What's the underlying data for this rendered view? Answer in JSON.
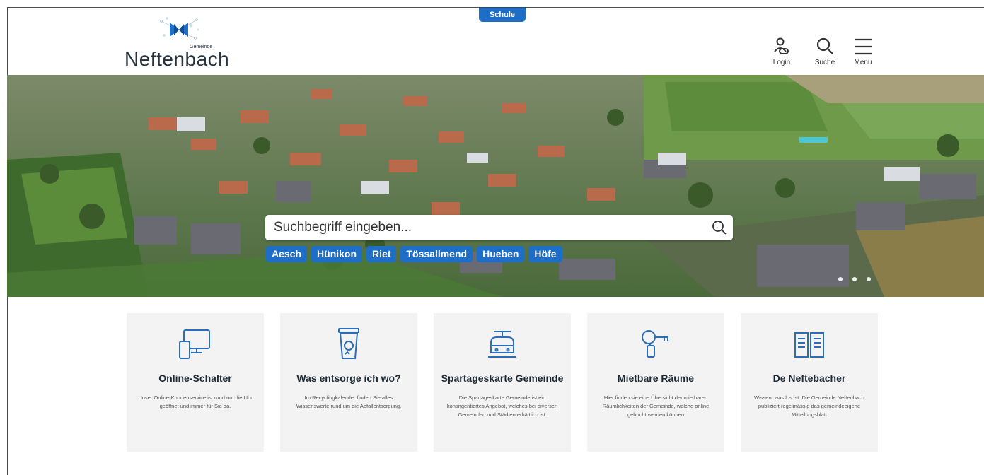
{
  "top_badge": "Schule",
  "logo": {
    "name": "Neftenbach",
    "small": "Gemeinde"
  },
  "header": {
    "login": "Login",
    "search": "Suche",
    "menu": "Menu"
  },
  "hero": {
    "search_placeholder": "Suchbegriff eingeben...",
    "chips": [
      "Aesch",
      "Hünikon",
      "Riet",
      "Tössallmend",
      "Hueben",
      "Höfe"
    ],
    "slides": 3
  },
  "cards": [
    {
      "title": "Online-Schalter",
      "text": "Unser Online-Kundenservice ist rund um die Uhr geöffnet und immer für Sie da.",
      "icon": "devices-icon"
    },
    {
      "title": "Was entsorge ich wo?",
      "text": "Im Recyclingkalender finden Sie alles Wissenswerte rund um die Abfallentsorgung.",
      "icon": "recycling-bin-icon"
    },
    {
      "title": "Spartageskarte Gemeinde",
      "text": "Die Spartageskarte Gemeinde ist ein kontingentiertes Angebot, welches bei diversen Gemeinden und Städten erhältlich ist.",
      "icon": "train-icon"
    },
    {
      "title": "Mietbare Räume",
      "text": "Hier finden sie eine Übersicht der mietbaren Räumlichkeiten der Gemeinde, welche online gebucht werden können",
      "icon": "key-icon"
    },
    {
      "title": "De Neftebacher",
      "text": "Wissen, was los ist. Die Gemeinde Neftenbach publiziert regelmässig das gemeindeeigene Mitteilungsblatt",
      "icon": "newspaper-icon"
    }
  ],
  "colors": {
    "accent": "#1e6ec7",
    "card_bg": "#f3f3f3",
    "icon": "#2a6db8"
  }
}
